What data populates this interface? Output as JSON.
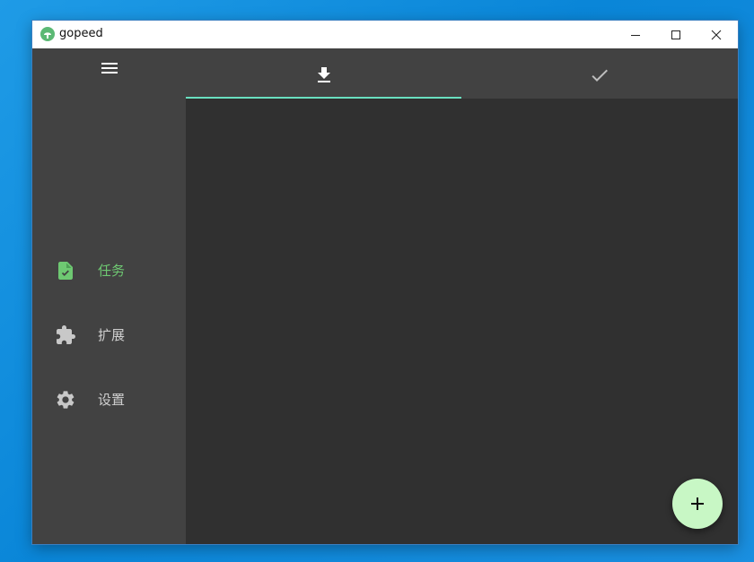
{
  "window": {
    "title": "gopeed"
  },
  "titlebar": {
    "logo_icon": "gopeed-logo-icon",
    "minimize_icon": "minimize-icon",
    "maximize_icon": "maximize-icon",
    "close_icon": "close-icon"
  },
  "sidebar": {
    "menu_icon": "hamburger-menu-icon",
    "items": [
      {
        "label": "任务",
        "icon": "task-file-icon",
        "active": true
      },
      {
        "label": "扩展",
        "icon": "puzzle-icon",
        "active": false
      },
      {
        "label": "设置",
        "icon": "gear-icon",
        "active": false
      }
    ]
  },
  "tabs": [
    {
      "icon": "download-icon",
      "selected": true
    },
    {
      "icon": "check-icon",
      "selected": false
    }
  ],
  "fab": {
    "icon": "plus-icon"
  },
  "colors": {
    "accent": "#6ec872",
    "tab_indicator": "#69e0c0",
    "fab_background": "#c8f7c5",
    "sidebar_background": "#424242",
    "content_background": "#303030"
  }
}
